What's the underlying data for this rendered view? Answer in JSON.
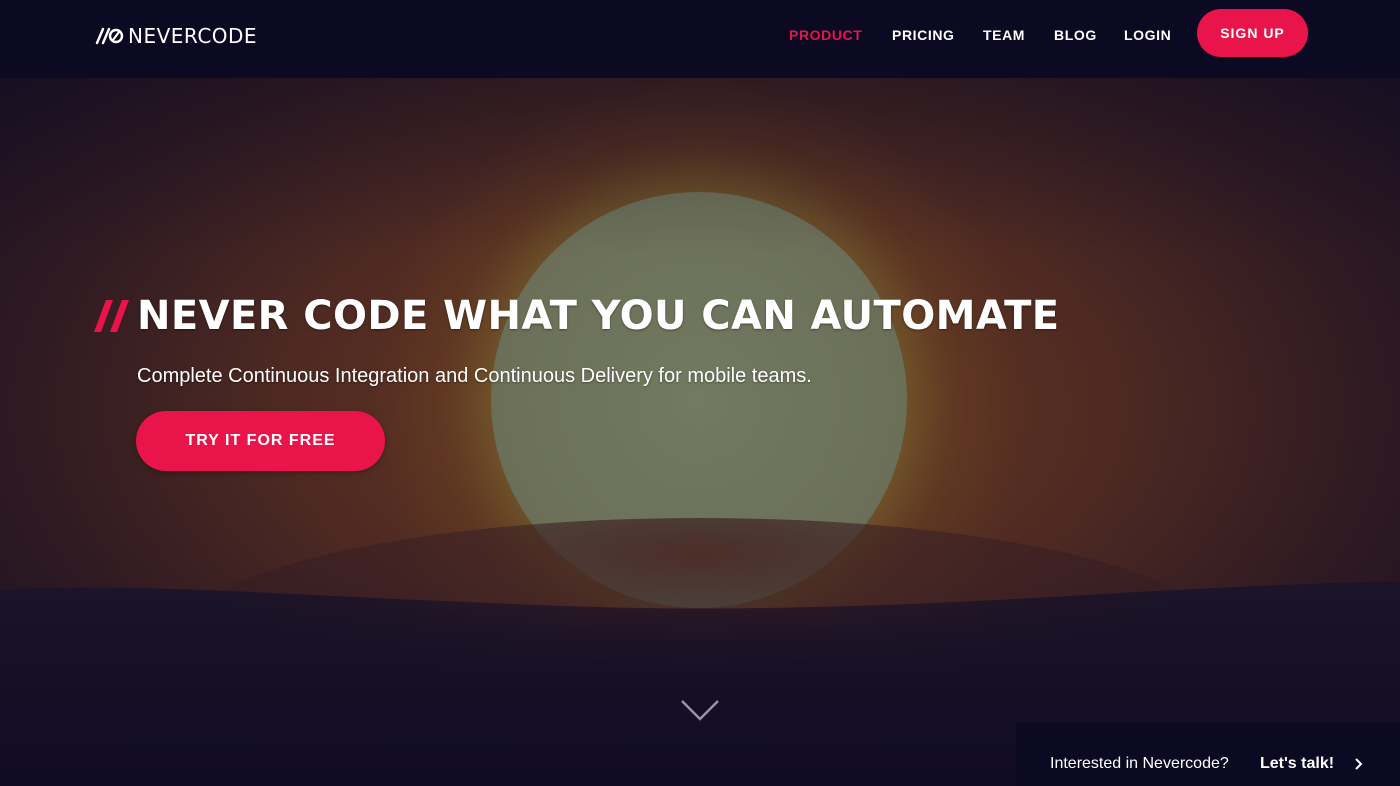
{
  "brand": {
    "name": "NEVERCODE",
    "logo_icon": "nevercode-logo-icon",
    "accent_color": "#e8144a",
    "nav_bg_color": "#0c0a22"
  },
  "nav": {
    "items": [
      {
        "label": "PRODUCT",
        "active": true
      },
      {
        "label": "PRICING",
        "active": false
      },
      {
        "label": "TEAM",
        "active": false
      },
      {
        "label": "BLOG",
        "active": false
      },
      {
        "label": "LOGIN",
        "active": false
      }
    ],
    "signup_label": "SIGN UP"
  },
  "hero": {
    "headline": "NEVER CODE WHAT YOU CAN AUTOMATE",
    "subheadline": "Complete Continuous Integration and Continuous Delivery for mobile teams.",
    "cta_label": "TRY IT FOR FREE",
    "background": "sunset-over-hills",
    "scroll_icon": "chevron-down-icon"
  },
  "chat": {
    "question": "Interested in Nevercode?",
    "action": "Let's talk!",
    "icon": "chevron-right-icon"
  }
}
